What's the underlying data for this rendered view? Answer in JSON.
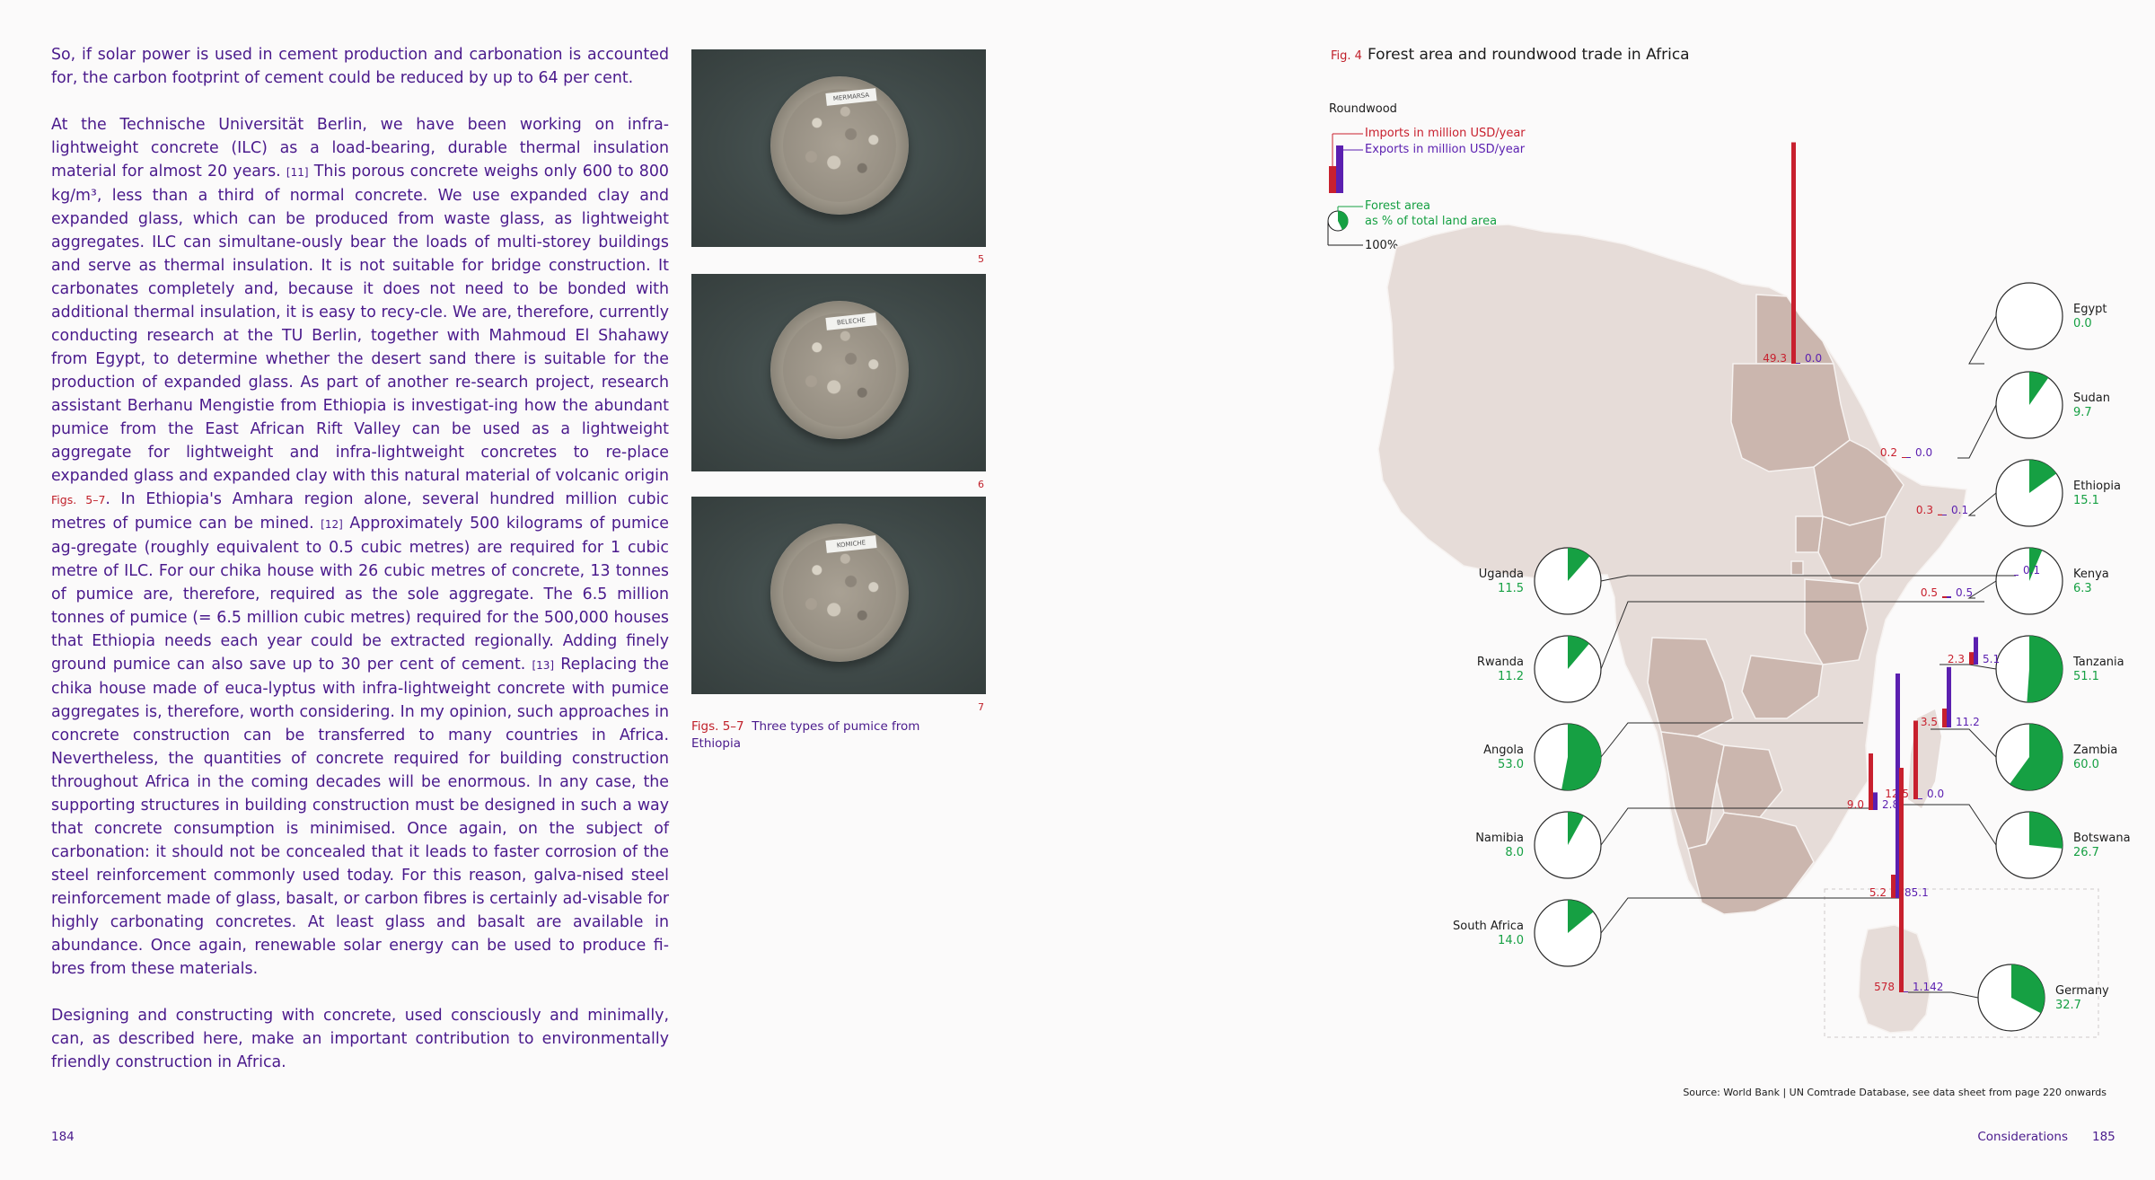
{
  "left_page": {
    "paragraphs": [
      [
        {
          "t": "text",
          "v": "So, if solar power is used in cement production and carbonation is accounted for, the carbon footprint of cement could be reduced by up to 64 per cent."
        }
      ],
      [
        {
          "t": "text",
          "v": "At the Technische Universität Berlin, we have been working on infra-lightweight concrete (ILC) as a load-bearing, durable thermal insulation material for almost 20 years. "
        },
        {
          "t": "ref",
          "v": "[11]"
        },
        {
          "t": "text",
          "v": " This porous concrete weighs only 600 to 800 kg/m³, less than a third of normal concrete. We use expanded clay and expanded glass, which can be produced from waste glass, as lightweight aggregates. ILC can simultane-ously bear the loads of multi-storey buildings and serve as thermal insulation. It is not suitable for bridge construction. It carbonates completely and, because it does not need to be bonded with additional thermal insulation, it is easy to recy-cle. We are, therefore, currently conducting research at the TU Berlin, together with Mahmoud El Shahawy from Egypt, to determine whether the desert sand there is suitable for the production of expanded glass. As part of another re-search project, research assistant Berhanu Mengistie from Ethiopia is investigat-ing how the abundant pumice from the East African Rift Valley can be used as a lightweight aggregate for lightweight and infra-lightweight concretes to re-place expanded glass and expanded clay with this natural material of volcanic origin "
        },
        {
          "t": "figref",
          "v": "Figs. 5–7"
        },
        {
          "t": "text",
          "v": ". In Ethiopia's Amhara region alone, several hundred million cubic metres of pumice can be mined. "
        },
        {
          "t": "ref",
          "v": "[12]"
        },
        {
          "t": "text",
          "v": " Approximately 500 kilograms of pumice ag-gregate (roughly equivalent to 0.5 cubic metres) are required for 1 cubic metre of ILC. For our chika house with 26 cubic metres of concrete, 13 tonnes of pumice are, therefore, required as the sole aggregate. The 6.5 million tonnes of pumice (= 6.5 million cubic metres) required for the 500,000 houses that Ethiopia needs each year could be extracted regionally. Adding finely ground pumice can also save up to 30 per cent of cement. "
        },
        {
          "t": "ref",
          "v": "[13]"
        },
        {
          "t": "text",
          "v": " Replacing the chika house made of euca-lyptus with infra-lightweight concrete with pumice aggregates is, therefore, worth considering. In my opinion, such approaches in concrete construction can be transferred to many countries in Africa. Nevertheless, the quantities of concrete required for building construction throughout Africa in the coming decades will be enormous. In any case, the supporting structures in building construction must be designed in such a way that concrete consumption is minimised. Once again, on the subject of carbonation: it should not be concealed that it leads to faster corrosion of the steel reinforcement commonly used today. For this reason, galva-nised steel reinforcement made of glass, basalt, or carbon fibres is certainly ad-visable for highly carbonating concretes. At least glass and basalt are available in abundance. Once again, renewable solar energy can be used to produce fi-bres from these materials."
        }
      ],
      [
        {
          "t": "text",
          "v": "Designing and constructing with concrete, used consciously and minimally, can, as described here, make an important contribution to environmentally friendly construction in Africa."
        }
      ]
    ],
    "photos": [
      {
        "label": "MERMARSA",
        "num": "5"
      },
      {
        "label": "BELECHE",
        "num": "6"
      },
      {
        "label": "KOMICHE",
        "num": "7"
      }
    ],
    "caption_num": "Figs. 5–7",
    "caption_text": "Three types of pumice from Ethiopia",
    "page_number": "184"
  },
  "right_page": {
    "fig_num": "Fig. 4",
    "fig_title": "Forest area and roundwood trade in Africa",
    "legend": {
      "title": "Roundwood",
      "imports": "Imports in million USD/year",
      "exports": "Exports in million USD/year",
      "forest_line1": "Forest area",
      "forest_line2": "as % of total land area",
      "full": "100%"
    },
    "source": "Source: World Bank | UN Comtrade Database, see data sheet from page 220 onwards",
    "section": "Considerations",
    "page_number": "185",
    "colors": {
      "imports": "#c8202e",
      "exports": "#5b1fb0",
      "forest": "#16a043",
      "map": "#e6dcd8",
      "highlight": "#cbb6ae"
    }
  },
  "chart_data": {
    "type": "map-pie-bar",
    "title": "Forest area and roundwood trade in Africa",
    "countries": [
      {
        "name": "Egypt",
        "forest": "0.0",
        "forest_pct": 0.0,
        "imports": "49.3",
        "exports": "0.0"
      },
      {
        "name": "Sudan",
        "forest": "9.7",
        "forest_pct": 9.7,
        "imports": "0.2",
        "exports": "0.0"
      },
      {
        "name": "Ethiopia",
        "forest": "15.1",
        "forest_pct": 15.1,
        "imports": "0.3",
        "exports": "0.1"
      },
      {
        "name": "Kenya",
        "forest": "6.3",
        "forest_pct": 6.3,
        "imports": "0.5",
        "exports": "0.5"
      },
      {
        "name": "Uganda",
        "forest": "11.5",
        "forest_pct": 11.5,
        "imports": "",
        "exports": "0.1"
      },
      {
        "name": "Tanzania",
        "forest": "51.1",
        "forest_pct": 51.1,
        "imports": "2.3",
        "exports": "5.1"
      },
      {
        "name": "Rwanda",
        "forest": "11.2",
        "forest_pct": 11.2,
        "imports": "",
        "exports": ""
      },
      {
        "name": "Zambia",
        "forest": "60.0",
        "forest_pct": 60.0,
        "imports": "3.5",
        "exports": "11.2"
      },
      {
        "name": "Angola",
        "forest": "53.0",
        "forest_pct": 53.0,
        "imports": "",
        "exports": ""
      },
      {
        "name": "Botswana",
        "forest": "26.7",
        "forest_pct": 26.7,
        "imports": "12.5",
        "exports": "0.0"
      },
      {
        "name": "Namibia",
        "forest": "8.0",
        "forest_pct": 8.0,
        "imports": "9.0",
        "exports": "2.8"
      },
      {
        "name": "South Africa",
        "forest": "14.0",
        "forest_pct": 14.0,
        "imports": "5.2",
        "exports": "85.1"
      },
      {
        "name": "Germany",
        "forest": "32.7",
        "forest_pct": 32.7,
        "imports": "578",
        "exports": "1.142"
      }
    ]
  }
}
